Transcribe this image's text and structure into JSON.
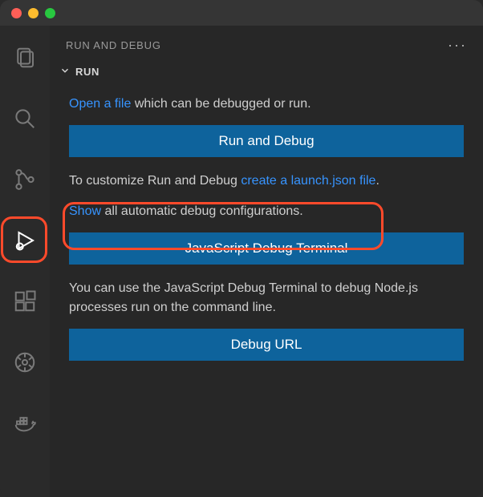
{
  "colors": {
    "accent_button": "#0e639c",
    "link": "#3794ff",
    "highlight": "#ff4a2b",
    "bg": "#272727"
  },
  "titlebar": {
    "close": "close-window",
    "minimize": "minimize-window",
    "maximize": "maximize-window"
  },
  "activitybar": {
    "items": [
      {
        "name": "explorer-icon"
      },
      {
        "name": "search-icon"
      },
      {
        "name": "scm-icon"
      },
      {
        "name": "run-debug-icon",
        "active": true
      },
      {
        "name": "extensions-icon"
      },
      {
        "name": "remote-icon"
      },
      {
        "name": "docker-icon"
      }
    ]
  },
  "sidebar": {
    "title": "RUN AND DEBUG",
    "more_label": "···",
    "section_label": "RUN",
    "open_file_link": "Open a file",
    "open_file_suffix": " which can be debugged or run.",
    "run_debug_button": "Run and Debug",
    "customize_prefix": "To customize Run and Debug ",
    "customize_link": "create a launch.json file",
    "customize_suffix": ".",
    "show_link": "Show",
    "show_suffix": " all automatic debug configurations.",
    "js_terminal_button": "JavaScript Debug Terminal",
    "js_terminal_desc": "You can use the JavaScript Debug Terminal to debug Node.js processes run on the command line.",
    "debug_url_button": "Debug URL"
  }
}
